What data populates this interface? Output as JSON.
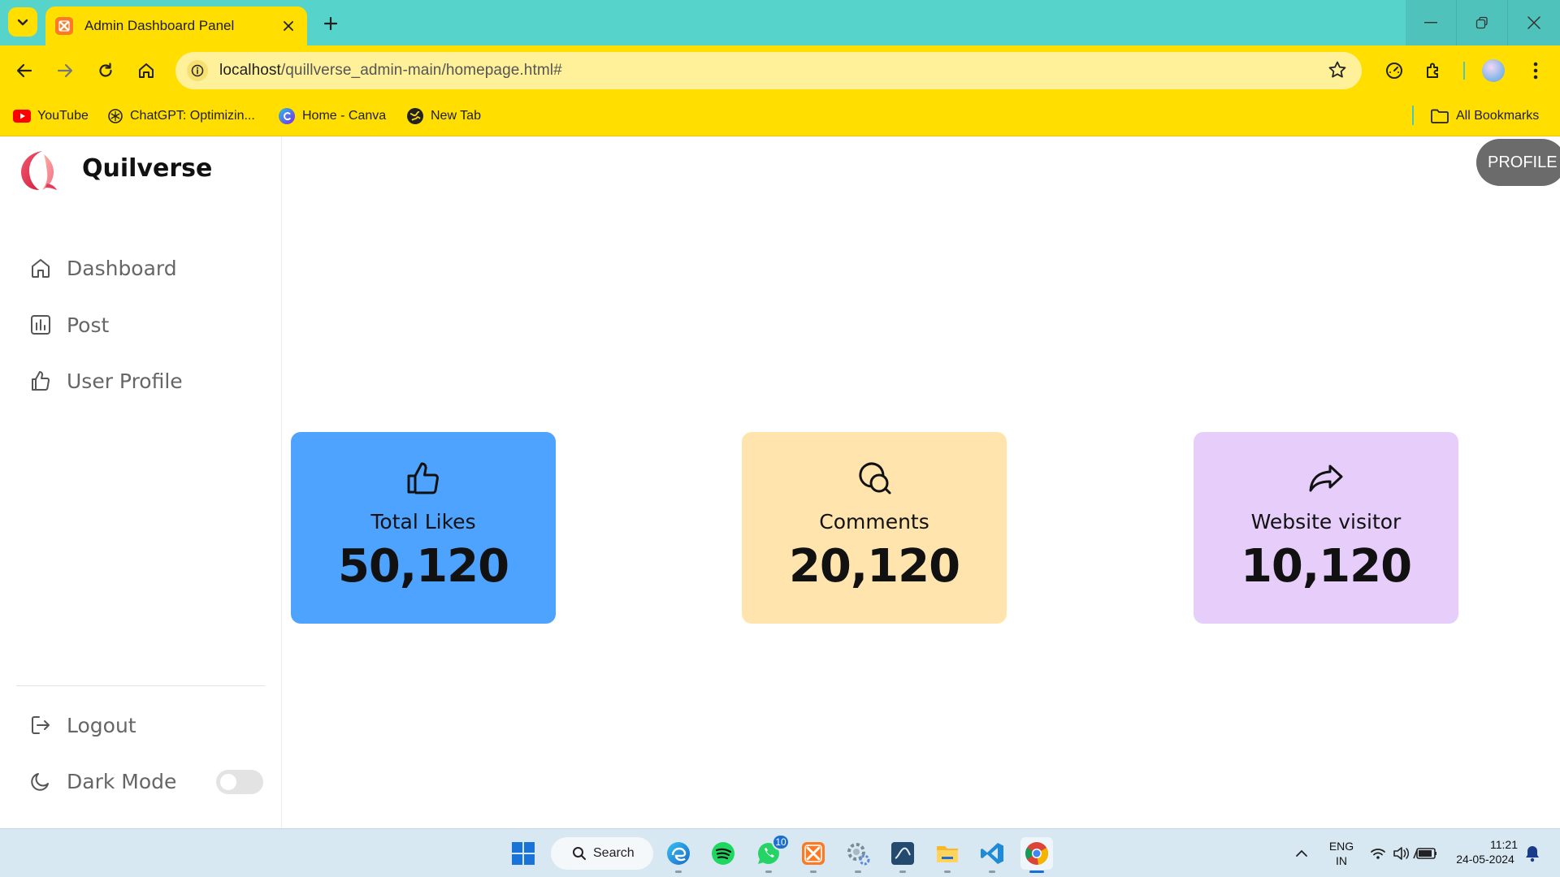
{
  "browser": {
    "tab": {
      "title": "Admin Dashboard Panel"
    },
    "address_bar": {
      "url_host": "localhost",
      "url_path": "/quillverse_admin-main/homepage.html#"
    },
    "bookmarks": [
      {
        "label": "YouTube",
        "icon": "youtube-icon"
      },
      {
        "label": "ChatGPT: Optimizin...",
        "icon": "chatgpt-icon"
      },
      {
        "label": "Home - Canva",
        "icon": "canva-icon"
      },
      {
        "label": "New Tab",
        "icon": "globe-icon"
      }
    ],
    "all_bookmarks_label": "All Bookmarks",
    "colors": {
      "tab_strip": "#56d3cb",
      "toolbar": "#ffde00",
      "omnibox": "#fff09a"
    }
  },
  "app": {
    "brand": "Quilverse",
    "nav": [
      {
        "label": "Dashboard",
        "icon": "home-icon"
      },
      {
        "label": "Post",
        "icon": "chart-icon"
      },
      {
        "label": "User Profile",
        "icon": "thumbs-up-icon"
      }
    ],
    "logout_label": "Logout",
    "dark_mode_label": "Dark Mode",
    "dark_mode_enabled": false,
    "profile_button": "PROFILE",
    "cards": [
      {
        "label": "Total Likes",
        "value": "50,120",
        "icon": "thumbs-up-icon",
        "color": "#4ea3ff"
      },
      {
        "label": "Comments",
        "value": "20,120",
        "icon": "chat-bubbles-icon",
        "color": "#ffe5ad"
      },
      {
        "label": "Website visitor",
        "value": "10,120",
        "icon": "share-arrow-icon",
        "color": "#e6cdfa"
      }
    ]
  },
  "taskbar": {
    "search_label": "Search",
    "whatsapp_badge": "10",
    "language": "ENG",
    "region": "IN",
    "time": "11:21",
    "date": "24-05-2024"
  }
}
